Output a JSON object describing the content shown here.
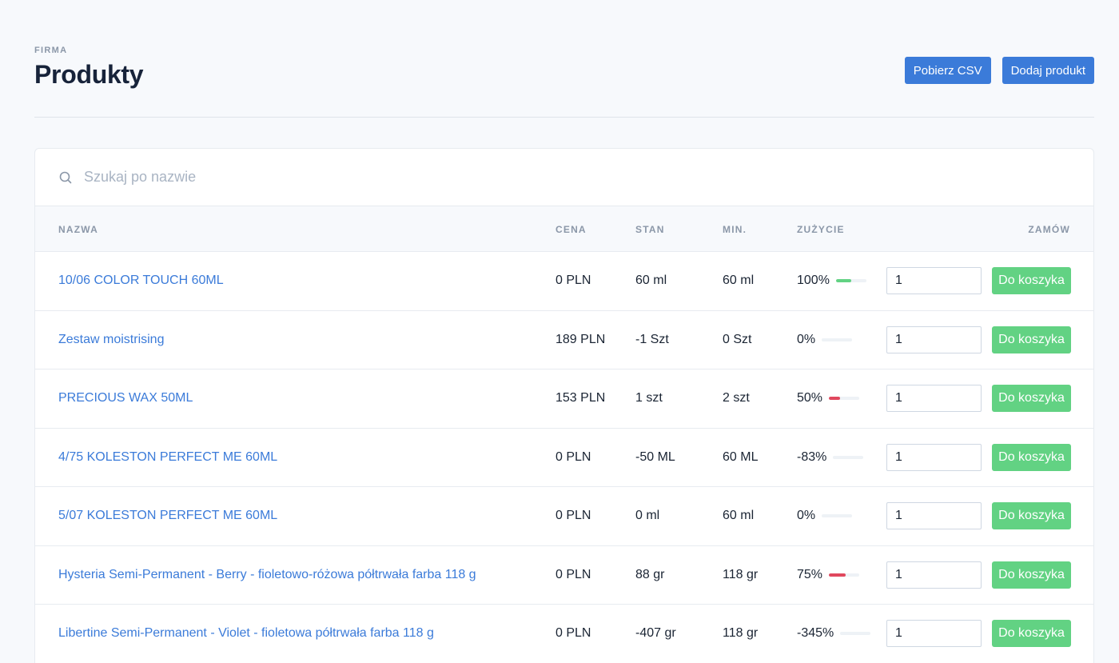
{
  "header": {
    "eyebrow": "FIRMA",
    "title": "Produkty",
    "download_csv_label": "Pobierz CSV",
    "add_product_label": "Dodaj produkt"
  },
  "search": {
    "placeholder": "Szukaj po nazwie",
    "value": ""
  },
  "table": {
    "headers": {
      "name": "NAZWA",
      "price": "CENA",
      "stock": "STAN",
      "min": "MIN.",
      "usage": "ZUŻYCIE",
      "order": "ZAMÓW"
    },
    "rows": [
      {
        "name": "10/06 COLOR TOUCH 60ML",
        "price": "0 PLN",
        "stock": "60 ml",
        "min": "60 ml",
        "usage": "100%",
        "usage_fraction": 0.5,
        "usage_color": "#62d283",
        "qty": "1",
        "cart_label": "Do koszyka"
      },
      {
        "name": "Zestaw moistrising",
        "price": "189 PLN",
        "stock": "-1 Szt",
        "min": "0 Szt",
        "usage": "0%",
        "usage_fraction": 0,
        "usage_color": "#e0485e",
        "qty": "1",
        "cart_label": "Do koszyka"
      },
      {
        "name": "PRECIOUS WAX 50ML",
        "price": "153 PLN",
        "stock": "1 szt",
        "min": "2 szt",
        "usage": "50%",
        "usage_fraction": 0.37,
        "usage_color": "#e0485e",
        "qty": "1",
        "cart_label": "Do koszyka"
      },
      {
        "name": "4/75 KOLESTON PERFECT ME 60ML",
        "price": "0 PLN",
        "stock": "-50 ML",
        "min": "60 ML",
        "usage": "-83%",
        "usage_fraction": 0,
        "usage_color": "#e0485e",
        "qty": "1",
        "cart_label": "Do koszyka"
      },
      {
        "name": "5/07 KOLESTON PERFECT ME 60ML",
        "price": "0 PLN",
        "stock": "0 ml",
        "min": "60 ml",
        "usage": "0%",
        "usage_fraction": 0,
        "usage_color": "#e0485e",
        "qty": "1",
        "cart_label": "Do koszyka"
      },
      {
        "name": "Hysteria Semi-Permanent - Berry - fioletowo-różowa półtrwała farba 118 g",
        "price": "0 PLN",
        "stock": "88 gr",
        "min": "118 gr",
        "usage": "75%",
        "usage_fraction": 0.56,
        "usage_color": "#e0485e",
        "qty": "1",
        "cart_label": "Do koszyka"
      },
      {
        "name": "Libertine Semi-Permanent - Violet - fioletowa półtrwała farba 118 g",
        "price": "0 PLN",
        "stock": "-407 gr",
        "min": "118 gr",
        "usage": "-345%",
        "usage_fraction": 0,
        "usage_color": "#e0485e",
        "qty": "1",
        "cart_label": "Do koszyka"
      }
    ]
  },
  "colors": {
    "accent": "#3b7bd9",
    "success": "#62d283",
    "danger": "#e0485e"
  }
}
